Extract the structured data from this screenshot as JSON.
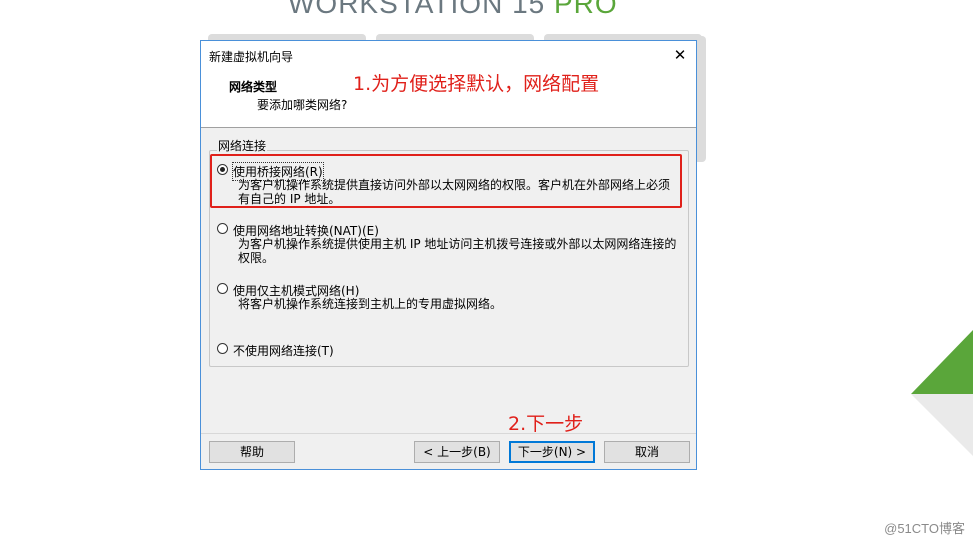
{
  "background": {
    "title": "WORKSTATION 15",
    "title_pro": "PRO",
    "title_tm": "™",
    "watermark": "@51CTO博客"
  },
  "dialog": {
    "title": "新建虚拟机向导",
    "close_glyph": "✕",
    "header_title": "网络类型",
    "header_subtitle": "要添加哪类网络?",
    "annotation_1": "1.为方便选择默认，网络配置",
    "group_label": "网络连接",
    "options": [
      {
        "label": "使用桥接网络(R)",
        "description": "为客户机操作系统提供直接访问外部以太网网络的权限。客户机在外部网络上必须有自己的 IP 地址。",
        "checked": true
      },
      {
        "label": "使用网络地址转换(NAT)(E)",
        "description": "为客户机操作系统提供使用主机 IP 地址访问主机拨号连接或外部以太网网络连接的权限。",
        "checked": false
      },
      {
        "label": "使用仅主机模式网络(H)",
        "description": "将客户机操作系统连接到主机上的专用虚拟网络。",
        "checked": false
      },
      {
        "label": "不使用网络连接(T)",
        "description": "",
        "checked": false
      }
    ],
    "annotation_2": "2.下一步",
    "buttons": {
      "help": "帮助",
      "back": "< 上一步(B)",
      "next": "下一步(N) >",
      "cancel": "取消"
    }
  },
  "colors": {
    "annotation_red": "#e0201a",
    "accent_blue": "#0078d7",
    "brand_green": "#5aa63a"
  }
}
